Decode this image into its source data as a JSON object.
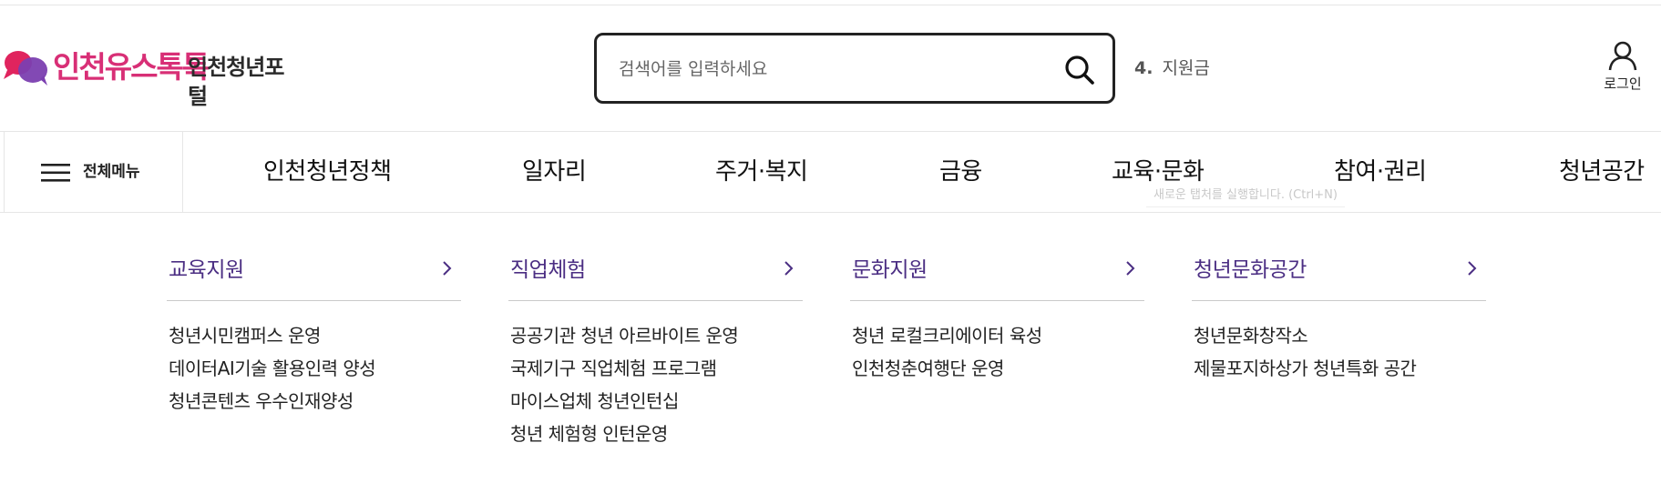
{
  "logo": {
    "brand": "인천유스톡톡",
    "portal": "인천청년포털",
    "colors": {
      "pink": "#e0245e",
      "purple": "#7b3fb0"
    }
  },
  "search": {
    "placeholder": "검색어를 입력하세요",
    "value": "",
    "icon": "search-icon"
  },
  "trending": {
    "rank": "4.",
    "keyword": "지원금"
  },
  "login": {
    "label": "로그인",
    "icon": "user-icon"
  },
  "gnb": {
    "all_menu_label": "전체메뉴",
    "items": [
      "인천청년정책",
      "일자리",
      "주거·복지",
      "금융",
      "교육·문화",
      "참여·권리",
      "청년공간"
    ]
  },
  "tooltip": "새로운 탭처를 실행합니다. (Ctrl+N)",
  "submenu": [
    {
      "title": "교육지원",
      "items": [
        "청년시민캠퍼스 운영",
        "데이터AI기술 활용인력 양성",
        "청년콘텐츠 우수인재양성"
      ]
    },
    {
      "title": "직업체험",
      "items": [
        "공공기관 청년 아르바이트 운영",
        "국제기구 직업체험 프로그램",
        "마이스업체 청년인턴십",
        "청년 체험형 인턴운영"
      ]
    },
    {
      "title": "문화지원",
      "items": [
        "청년 로컬크리에이터 육성",
        "인천청춘여행단 운영"
      ]
    },
    {
      "title": "청년문화공간",
      "items": [
        "청년문화창작소",
        "제물포지하상가 청년특화 공간"
      ]
    }
  ],
  "colors": {
    "accent": "#4b2e83",
    "divider": "#e6e6e6"
  }
}
